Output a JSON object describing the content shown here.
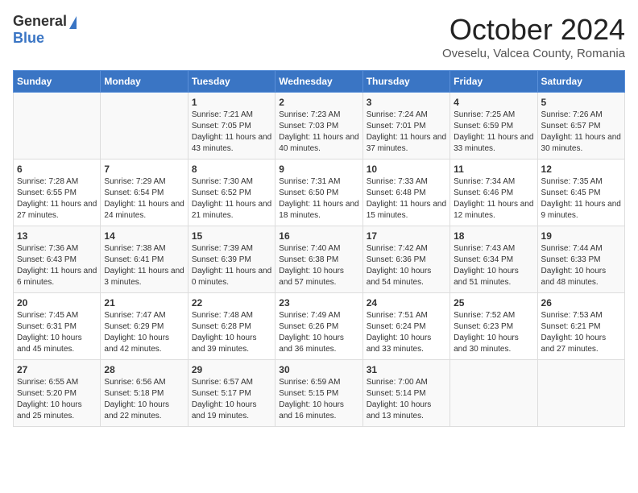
{
  "header": {
    "logo_general": "General",
    "logo_blue": "Blue",
    "month": "October 2024",
    "location": "Oveselu, Valcea County, Romania"
  },
  "days_of_week": [
    "Sunday",
    "Monday",
    "Tuesday",
    "Wednesday",
    "Thursday",
    "Friday",
    "Saturday"
  ],
  "weeks": [
    [
      {
        "day": "",
        "sunrise": "",
        "sunset": "",
        "daylight": ""
      },
      {
        "day": "",
        "sunrise": "",
        "sunset": "",
        "daylight": ""
      },
      {
        "day": "1",
        "sunrise": "Sunrise: 7:21 AM",
        "sunset": "Sunset: 7:05 PM",
        "daylight": "Daylight: 11 hours and 43 minutes."
      },
      {
        "day": "2",
        "sunrise": "Sunrise: 7:23 AM",
        "sunset": "Sunset: 7:03 PM",
        "daylight": "Daylight: 11 hours and 40 minutes."
      },
      {
        "day": "3",
        "sunrise": "Sunrise: 7:24 AM",
        "sunset": "Sunset: 7:01 PM",
        "daylight": "Daylight: 11 hours and 37 minutes."
      },
      {
        "day": "4",
        "sunrise": "Sunrise: 7:25 AM",
        "sunset": "Sunset: 6:59 PM",
        "daylight": "Daylight: 11 hours and 33 minutes."
      },
      {
        "day": "5",
        "sunrise": "Sunrise: 7:26 AM",
        "sunset": "Sunset: 6:57 PM",
        "daylight": "Daylight: 11 hours and 30 minutes."
      }
    ],
    [
      {
        "day": "6",
        "sunrise": "Sunrise: 7:28 AM",
        "sunset": "Sunset: 6:55 PM",
        "daylight": "Daylight: 11 hours and 27 minutes."
      },
      {
        "day": "7",
        "sunrise": "Sunrise: 7:29 AM",
        "sunset": "Sunset: 6:54 PM",
        "daylight": "Daylight: 11 hours and 24 minutes."
      },
      {
        "day": "8",
        "sunrise": "Sunrise: 7:30 AM",
        "sunset": "Sunset: 6:52 PM",
        "daylight": "Daylight: 11 hours and 21 minutes."
      },
      {
        "day": "9",
        "sunrise": "Sunrise: 7:31 AM",
        "sunset": "Sunset: 6:50 PM",
        "daylight": "Daylight: 11 hours and 18 minutes."
      },
      {
        "day": "10",
        "sunrise": "Sunrise: 7:33 AM",
        "sunset": "Sunset: 6:48 PM",
        "daylight": "Daylight: 11 hours and 15 minutes."
      },
      {
        "day": "11",
        "sunrise": "Sunrise: 7:34 AM",
        "sunset": "Sunset: 6:46 PM",
        "daylight": "Daylight: 11 hours and 12 minutes."
      },
      {
        "day": "12",
        "sunrise": "Sunrise: 7:35 AM",
        "sunset": "Sunset: 6:45 PM",
        "daylight": "Daylight: 11 hours and 9 minutes."
      }
    ],
    [
      {
        "day": "13",
        "sunrise": "Sunrise: 7:36 AM",
        "sunset": "Sunset: 6:43 PM",
        "daylight": "Daylight: 11 hours and 6 minutes."
      },
      {
        "day": "14",
        "sunrise": "Sunrise: 7:38 AM",
        "sunset": "Sunset: 6:41 PM",
        "daylight": "Daylight: 11 hours and 3 minutes."
      },
      {
        "day": "15",
        "sunrise": "Sunrise: 7:39 AM",
        "sunset": "Sunset: 6:39 PM",
        "daylight": "Daylight: 11 hours and 0 minutes."
      },
      {
        "day": "16",
        "sunrise": "Sunrise: 7:40 AM",
        "sunset": "Sunset: 6:38 PM",
        "daylight": "Daylight: 10 hours and 57 minutes."
      },
      {
        "day": "17",
        "sunrise": "Sunrise: 7:42 AM",
        "sunset": "Sunset: 6:36 PM",
        "daylight": "Daylight: 10 hours and 54 minutes."
      },
      {
        "day": "18",
        "sunrise": "Sunrise: 7:43 AM",
        "sunset": "Sunset: 6:34 PM",
        "daylight": "Daylight: 10 hours and 51 minutes."
      },
      {
        "day": "19",
        "sunrise": "Sunrise: 7:44 AM",
        "sunset": "Sunset: 6:33 PM",
        "daylight": "Daylight: 10 hours and 48 minutes."
      }
    ],
    [
      {
        "day": "20",
        "sunrise": "Sunrise: 7:45 AM",
        "sunset": "Sunset: 6:31 PM",
        "daylight": "Daylight: 10 hours and 45 minutes."
      },
      {
        "day": "21",
        "sunrise": "Sunrise: 7:47 AM",
        "sunset": "Sunset: 6:29 PM",
        "daylight": "Daylight: 10 hours and 42 minutes."
      },
      {
        "day": "22",
        "sunrise": "Sunrise: 7:48 AM",
        "sunset": "Sunset: 6:28 PM",
        "daylight": "Daylight: 10 hours and 39 minutes."
      },
      {
        "day": "23",
        "sunrise": "Sunrise: 7:49 AM",
        "sunset": "Sunset: 6:26 PM",
        "daylight": "Daylight: 10 hours and 36 minutes."
      },
      {
        "day": "24",
        "sunrise": "Sunrise: 7:51 AM",
        "sunset": "Sunset: 6:24 PM",
        "daylight": "Daylight: 10 hours and 33 minutes."
      },
      {
        "day": "25",
        "sunrise": "Sunrise: 7:52 AM",
        "sunset": "Sunset: 6:23 PM",
        "daylight": "Daylight: 10 hours and 30 minutes."
      },
      {
        "day": "26",
        "sunrise": "Sunrise: 7:53 AM",
        "sunset": "Sunset: 6:21 PM",
        "daylight": "Daylight: 10 hours and 27 minutes."
      }
    ],
    [
      {
        "day": "27",
        "sunrise": "Sunrise: 6:55 AM",
        "sunset": "Sunset: 5:20 PM",
        "daylight": "Daylight: 10 hours and 25 minutes."
      },
      {
        "day": "28",
        "sunrise": "Sunrise: 6:56 AM",
        "sunset": "Sunset: 5:18 PM",
        "daylight": "Daylight: 10 hours and 22 minutes."
      },
      {
        "day": "29",
        "sunrise": "Sunrise: 6:57 AM",
        "sunset": "Sunset: 5:17 PM",
        "daylight": "Daylight: 10 hours and 19 minutes."
      },
      {
        "day": "30",
        "sunrise": "Sunrise: 6:59 AM",
        "sunset": "Sunset: 5:15 PM",
        "daylight": "Daylight: 10 hours and 16 minutes."
      },
      {
        "day": "31",
        "sunrise": "Sunrise: 7:00 AM",
        "sunset": "Sunset: 5:14 PM",
        "daylight": "Daylight: 10 hours and 13 minutes."
      },
      {
        "day": "",
        "sunrise": "",
        "sunset": "",
        "daylight": ""
      },
      {
        "day": "",
        "sunrise": "",
        "sunset": "",
        "daylight": ""
      }
    ]
  ]
}
